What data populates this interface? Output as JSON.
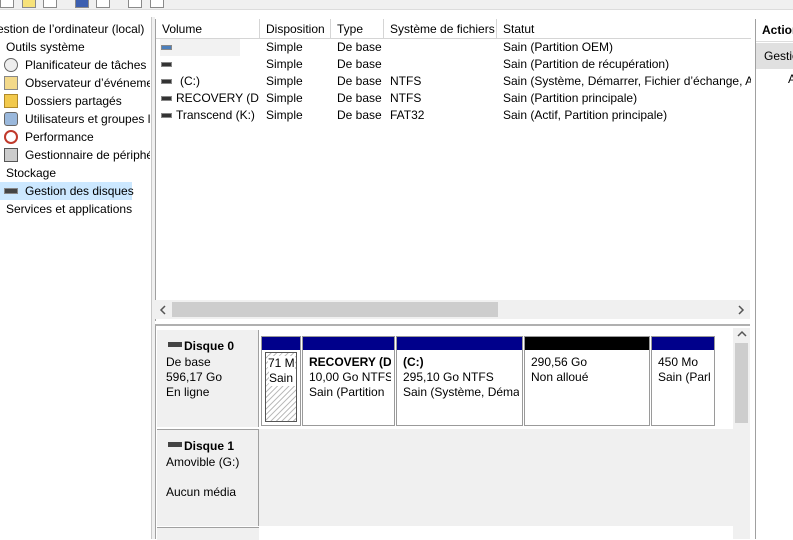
{
  "tree": {
    "items": [
      {
        "label": "estion de l’ordinateur (local)",
        "icon": ""
      },
      {
        "label": "Outils système",
        "icon": ""
      },
      {
        "label": "Planificateur de tâches",
        "icon": "clock-icon"
      },
      {
        "label": "Observateur d’événeme",
        "icon": "event-viewer-icon"
      },
      {
        "label": "Dossiers partagés",
        "icon": "shared-folder-icon"
      },
      {
        "label": "Utilisateurs et groupes l",
        "icon": "users-icon"
      },
      {
        "label": "Performance",
        "icon": "performance-icon"
      },
      {
        "label": "Gestionnaire de périphé",
        "icon": "device-manager-icon"
      },
      {
        "label": "Stockage",
        "icon": ""
      },
      {
        "label": "Gestion des disques",
        "icon": "disk-management-icon"
      },
      {
        "label": "Services et applications",
        "icon": ""
      }
    ]
  },
  "list": {
    "columns": [
      "Volume",
      "Disposition",
      "Type",
      "Système de fichiers",
      "Statut"
    ],
    "rows": [
      {
        "volume": "",
        "layout": "Simple",
        "type": "De base",
        "fs": "",
        "status": "Sain (Partition OEM)"
      },
      {
        "volume": "",
        "layout": "Simple",
        "type": "De base",
        "fs": "",
        "status": "Sain (Partition de récupération)"
      },
      {
        "volume": "(C:)",
        "layout": "Simple",
        "type": "De base",
        "fs": "NTFS",
        "status": "Sain (Système, Démarrer, Fichier d’échange, Ac"
      },
      {
        "volume": "RECOVERY (D:)",
        "layout": "Simple",
        "type": "De base",
        "fs": "NTFS",
        "status": "Sain (Partition principale)"
      },
      {
        "volume": "Transcend (K:)",
        "layout": "Simple",
        "type": "De base",
        "fs": "FAT32",
        "status": "Sain (Actif, Partition principale)"
      }
    ]
  },
  "actions": {
    "header": "Action",
    "item": "Gestio",
    "sub": "A"
  },
  "disks": [
    {
      "title": "Disque 0",
      "line1": "De base",
      "line2": "596,17 Go",
      "line3": "En ligne"
    },
    {
      "title": "Disque 1",
      "line1": "Amovible (G:)",
      "line2": "Aucun média"
    }
  ],
  "partitions": [
    {
      "name": "",
      "size": "71 M",
      "status": "Sain (",
      "bar_color": "#00008b"
    },
    {
      "name": "RECOVERY  (D",
      "size": "10,00 Go NTFS",
      "status": "Sain (Partition",
      "bar_color": "#00008b"
    },
    {
      "name": "(C:)",
      "size": "295,10 Go NTFS",
      "status": "Sain (Système, Démai",
      "bar_color": "#00008b"
    },
    {
      "name": "",
      "size": "290,56 Go",
      "status": "Non alloué",
      "bar_color": "#000000"
    },
    {
      "name": "",
      "size": "450 Mo",
      "status": "Sain (Parl",
      "bar_color": "#00008b"
    }
  ]
}
